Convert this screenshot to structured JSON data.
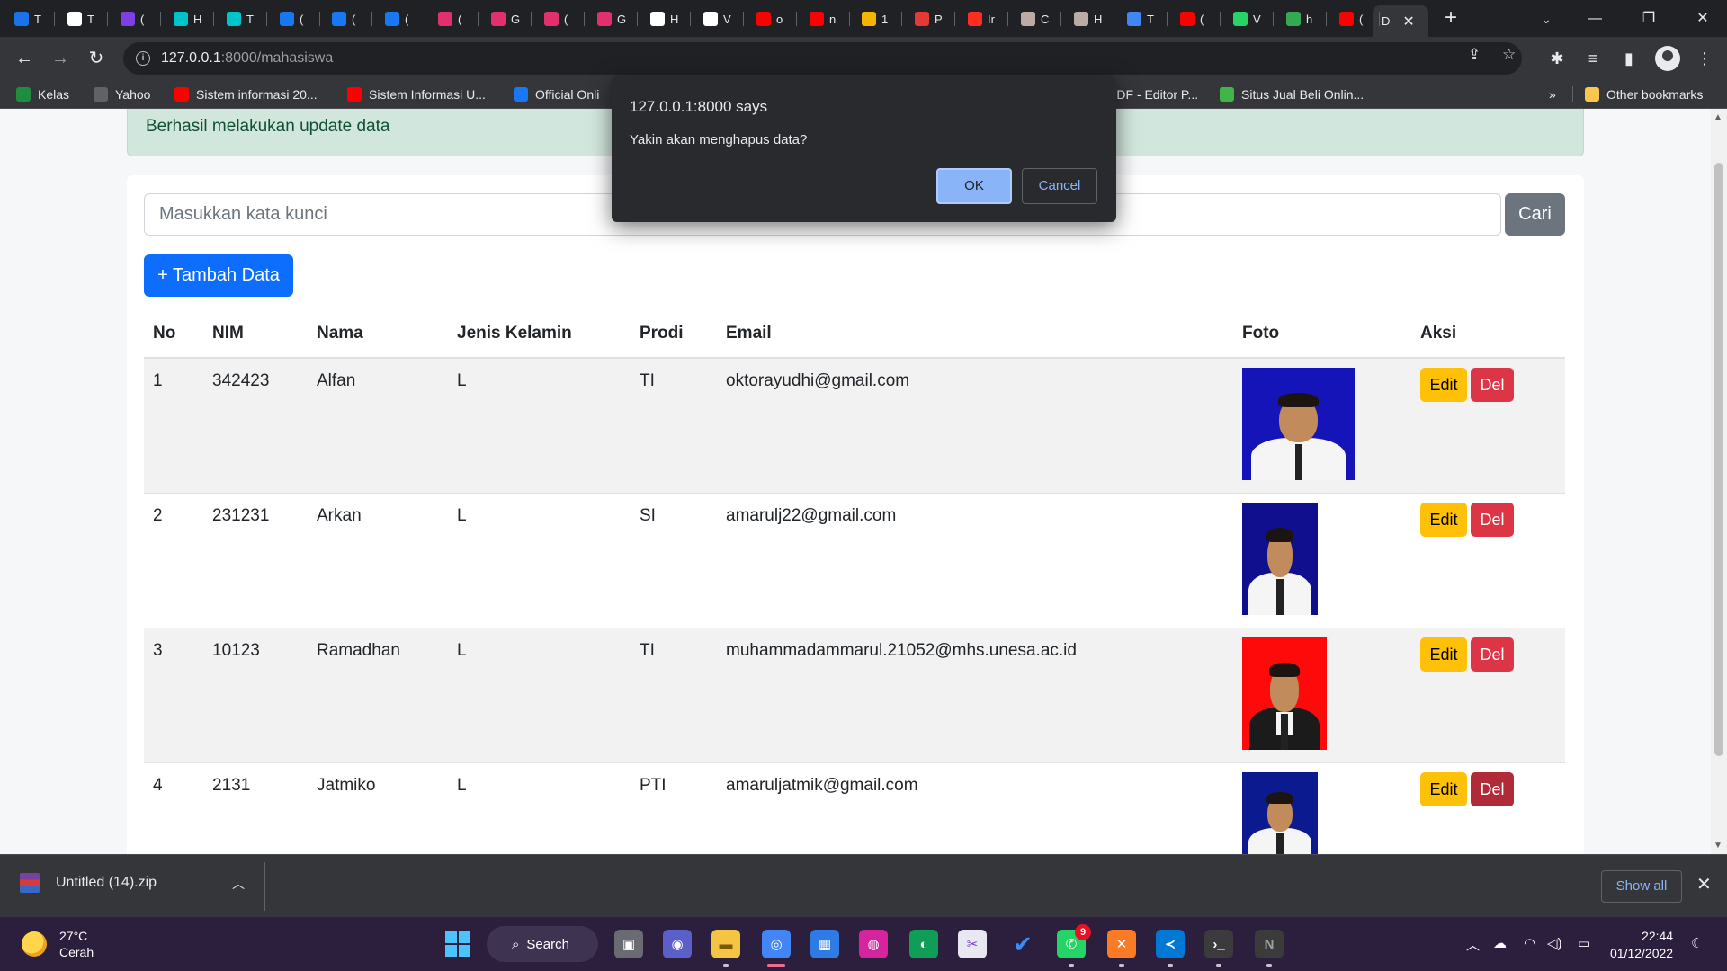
{
  "browser": {
    "tabs": [
      {
        "label": "T",
        "icon": "classroom-icon",
        "color": "#1a73e8"
      },
      {
        "label": "T",
        "icon": "github-icon",
        "color": "#ffffff"
      },
      {
        "label": "(",
        "icon": "mail-icon",
        "color": "#7b3fe4"
      },
      {
        "label": "H",
        "icon": "canva-icon",
        "color": "#00c4cc"
      },
      {
        "label": "T",
        "icon": "canva-icon",
        "color": "#00c4cc"
      },
      {
        "label": "(",
        "icon": "facebook-icon",
        "color": "#1877f2"
      },
      {
        "label": "(",
        "icon": "facebook-icon",
        "color": "#1877f2"
      },
      {
        "label": "(",
        "icon": "facebook-icon",
        "color": "#1877f2"
      },
      {
        "label": "(",
        "icon": "instagram-icon",
        "color": "#e1306c"
      },
      {
        "label": "G",
        "icon": "instagram-icon",
        "color": "#e1306c"
      },
      {
        "label": "(",
        "icon": "instagram-icon",
        "color": "#e1306c"
      },
      {
        "label": "G",
        "icon": "instagram-icon",
        "color": "#e1306c"
      },
      {
        "label": "H",
        "icon": "wix-icon",
        "color": "#ffffff"
      },
      {
        "label": "V",
        "icon": "wix-icon",
        "color": "#ffffff"
      },
      {
        "label": "o",
        "icon": "youtube-icon",
        "color": "#ff0000"
      },
      {
        "label": "n",
        "icon": "youtube-icon",
        "color": "#ff0000"
      },
      {
        "label": "1",
        "icon": "pyramid-icon",
        "color": "#f4b400"
      },
      {
        "label": "P",
        "icon": "notion-icon",
        "color": "#e53935"
      },
      {
        "label": "Ir",
        "icon": "laravel-icon",
        "color": "#ff2d20"
      },
      {
        "label": "C",
        "icon": "owl-icon",
        "color": "#bcaaa4"
      },
      {
        "label": "H",
        "icon": "owl-icon",
        "color": "#bcaaa4"
      },
      {
        "label": "T",
        "icon": "code-icon",
        "color": "#4285f4"
      },
      {
        "label": "(",
        "icon": "youtube-icon",
        "color": "#ff0000"
      },
      {
        "label": "V",
        "icon": "whatsapp-icon",
        "color": "#25d366"
      },
      {
        "label": "h",
        "icon": "check-icon",
        "color": "#34a853"
      },
      {
        "label": "(",
        "icon": "youtube-icon",
        "color": "#ff0000"
      }
    ],
    "active_tab": {
      "label": "D",
      "icon": "page-icon"
    },
    "new_tab": "+",
    "window_controls": {
      "minimize": "—",
      "restore": "❐",
      "close": "✕",
      "tab_search": "⌄"
    },
    "nav": {
      "back": "←",
      "forward": "→",
      "reload": "↻"
    },
    "url": {
      "host": "127.0.0.1",
      "path": ":8000/mahasiswa"
    },
    "bookmarks": [
      {
        "label": "Kelas",
        "icon": "classroom-icon",
        "color": "#1e8e3e"
      },
      {
        "label": "Yahoo",
        "icon": "globe-icon",
        "color": "#5f6368"
      },
      {
        "label": "Sistem informasi 20...",
        "icon": "youtube-icon",
        "color": "#ff0000"
      },
      {
        "label": "Sistem Informasi U...",
        "icon": "youtube-icon",
        "color": "#ff0000"
      },
      {
        "label": "Official Onli",
        "icon": "facebook-icon",
        "color": "#1877f2"
      },
      {
        "label": "PDF - Editor P...",
        "icon": "pdf-icon",
        "color": "#d93025"
      },
      {
        "label": "Situs Jual Beli Onlin...",
        "icon": "shop-icon",
        "color": "#42b549"
      }
    ],
    "bookmarks_more": "»",
    "other_bookmarks": "Other bookmarks"
  },
  "page": {
    "alert": "Berhasil melakukan update data",
    "search": {
      "placeholder": "Masukkan kata kunci",
      "button": "Cari"
    },
    "add_button": "+ Tambah Data",
    "table": {
      "headers": [
        "No",
        "NIM",
        "Nama",
        "Jenis Kelamin",
        "Prodi",
        "Email",
        "Foto",
        "Aksi"
      ],
      "rows": [
        {
          "no": "1",
          "nim": "342423",
          "nama": "Alfan",
          "jk": "L",
          "prodi": "TI",
          "email": "oktorayudhi@gmail.com",
          "photo_bg": "#1414b8"
        },
        {
          "no": "2",
          "nim": "231231",
          "nama": "Arkan",
          "jk": "L",
          "prodi": "SI",
          "email": "amarulj22@gmail.com",
          "photo_bg": "#10108f"
        },
        {
          "no": "3",
          "nim": "10123",
          "nama": "Ramadhan",
          "jk": "L",
          "prodi": "TI",
          "email": "muhammadammarul.21052@mhs.unesa.ac.id",
          "photo_bg": "#ff0a0a"
        },
        {
          "no": "4",
          "nim": "2131",
          "nama": "Jatmiko",
          "jk": "L",
          "prodi": "PTI",
          "email": "amaruljatmik@gmail.com",
          "photo_bg": "#0c1a8f"
        }
      ],
      "edit_label": "Edit",
      "del_label": "Del"
    }
  },
  "dialog": {
    "title": "127.0.0.1:8000 says",
    "message": "Yakin akan menghapus data?",
    "ok": "OK",
    "cancel": "Cancel"
  },
  "downloads": {
    "file": "Untitled (14).zip",
    "show_all": "Show all",
    "close": "✕"
  },
  "taskbar": {
    "weather_temp": "27°C",
    "weather_desc": "Cerah",
    "search": "Search",
    "whatsapp_badge": "9",
    "time": "22:44",
    "date": "01/12/2022"
  },
  "colors": {
    "primary": "#0d6efd",
    "secondary": "#6c757d",
    "warning": "#ffc107",
    "danger": "#dc3545",
    "success_bg": "#d1e7dd",
    "dialog_bg": "#292a2d",
    "taskbar_bg": "#2b1f3d"
  }
}
